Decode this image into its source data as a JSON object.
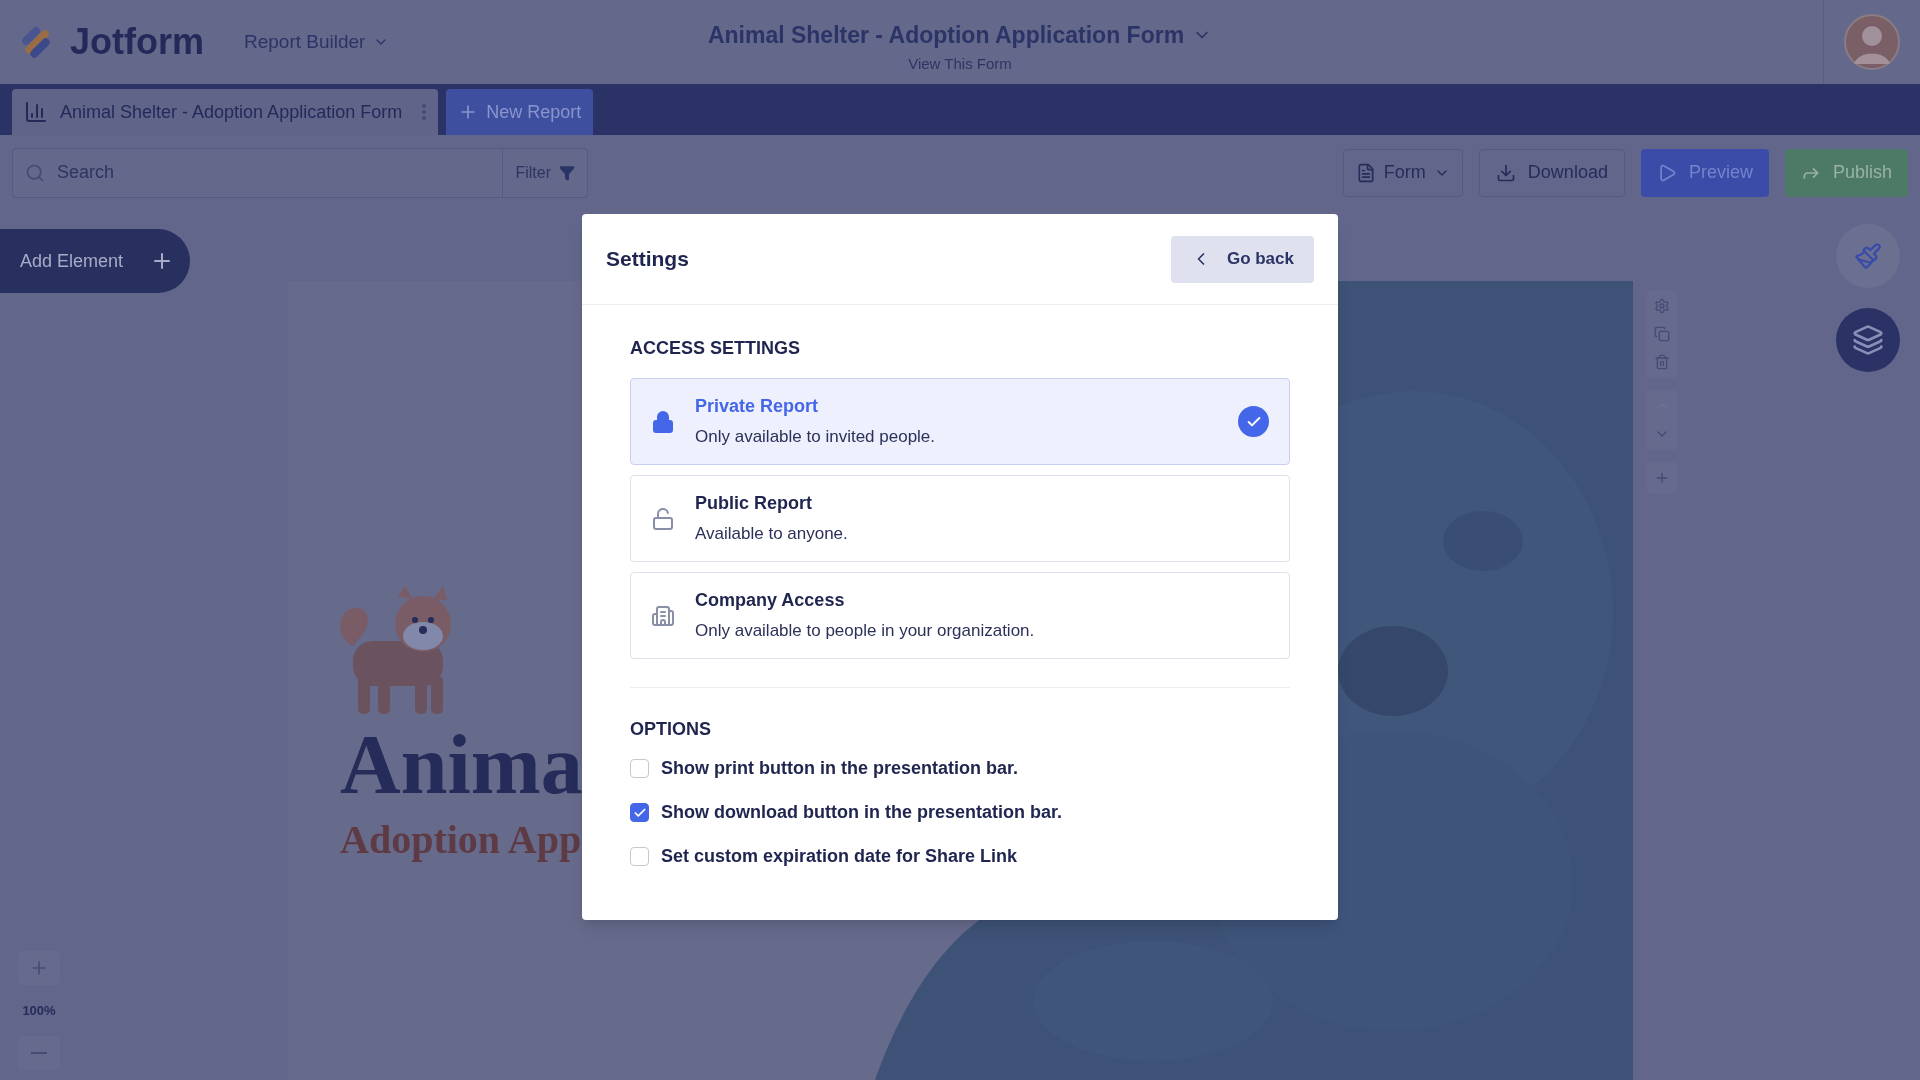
{
  "header": {
    "logo": "Jotform",
    "product": "Report Builder",
    "form_title": "Animal Shelter - Adoption Application Form",
    "form_link": "View This Form"
  },
  "tabs": [
    {
      "label": "Animal Shelter - Adoption Application Form",
      "selected": true
    }
  ],
  "new_report": "New Report",
  "toolbar": {
    "search": {
      "placeholder": "Search"
    },
    "filter": "Filter",
    "form_menu": "Form",
    "buttons": [
      {
        "kind": "download",
        "label": "Download"
      },
      {
        "kind": "preview",
        "label": "Preview"
      },
      {
        "kind": "publish",
        "label": "Publish"
      }
    ]
  },
  "canvas": {
    "add_element": "Add Element",
    "zoom": "100%",
    "heading": "Anima",
    "subheading": "Adoption App"
  },
  "settings": {
    "title": "Settings",
    "back": "Go back",
    "access_heading": "ACCESS SETTINGS",
    "access_options": [
      {
        "kind": "lock",
        "title": "Private Report",
        "description": "Only available to invited people.",
        "selected": true
      },
      {
        "kind": "unlock",
        "title": "Public Report",
        "description": "Available to anyone.",
        "selected": false
      },
      {
        "kind": "building",
        "title": "Company Access",
        "description": "Only available to people in your organization.",
        "selected": false
      }
    ],
    "options_heading": "OPTIONS",
    "options": [
      {
        "label": "Show print button in the presentation bar.",
        "checked": false
      },
      {
        "label": "Show download button in the presentation bar.",
        "checked": true
      },
      {
        "label": "Set custom expiration date for Share Link",
        "checked": false
      }
    ]
  }
}
